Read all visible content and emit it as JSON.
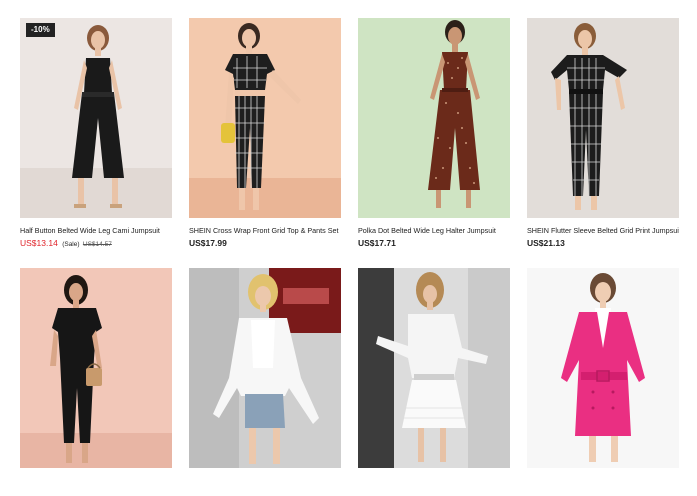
{
  "products": [
    {
      "title": "Half Button Belted Wide Leg Cami Jumpsuit",
      "price": "US$13.14",
      "sale_tag": "(Sale)",
      "old_price": "US$14.57",
      "badge": "-10%",
      "bg": "#ece6e3",
      "outfit": "#1a1a1a"
    },
    {
      "title": "SHEIN Cross Wrap Front Grid Top & Pants Set",
      "price": "US$17.99",
      "bg": "#f3c9ad",
      "outfit": "#1e1e1e"
    },
    {
      "title": "Polka Dot Belted Wide Leg Halter Jumpsuit",
      "price": "US$17.71",
      "bg": "#cfe4c3",
      "outfit": "#6b2a1a"
    },
    {
      "title": "SHEIN Flutter Sleeve Belted Grid Print Jumpsuit",
      "price": "US$21.13",
      "bg": "#e2ddd9",
      "outfit": "#1c1c1c"
    },
    {
      "bg": "#f2c7b8",
      "outfit": "#161616"
    },
    {
      "bg": "#cfcfcf",
      "outfit": "#f7f7f7"
    },
    {
      "bg": "#dcdcdc",
      "outfit": "#f5f5f5"
    },
    {
      "bg": "#f7f7f7",
      "outfit": "#ea2f82"
    }
  ]
}
